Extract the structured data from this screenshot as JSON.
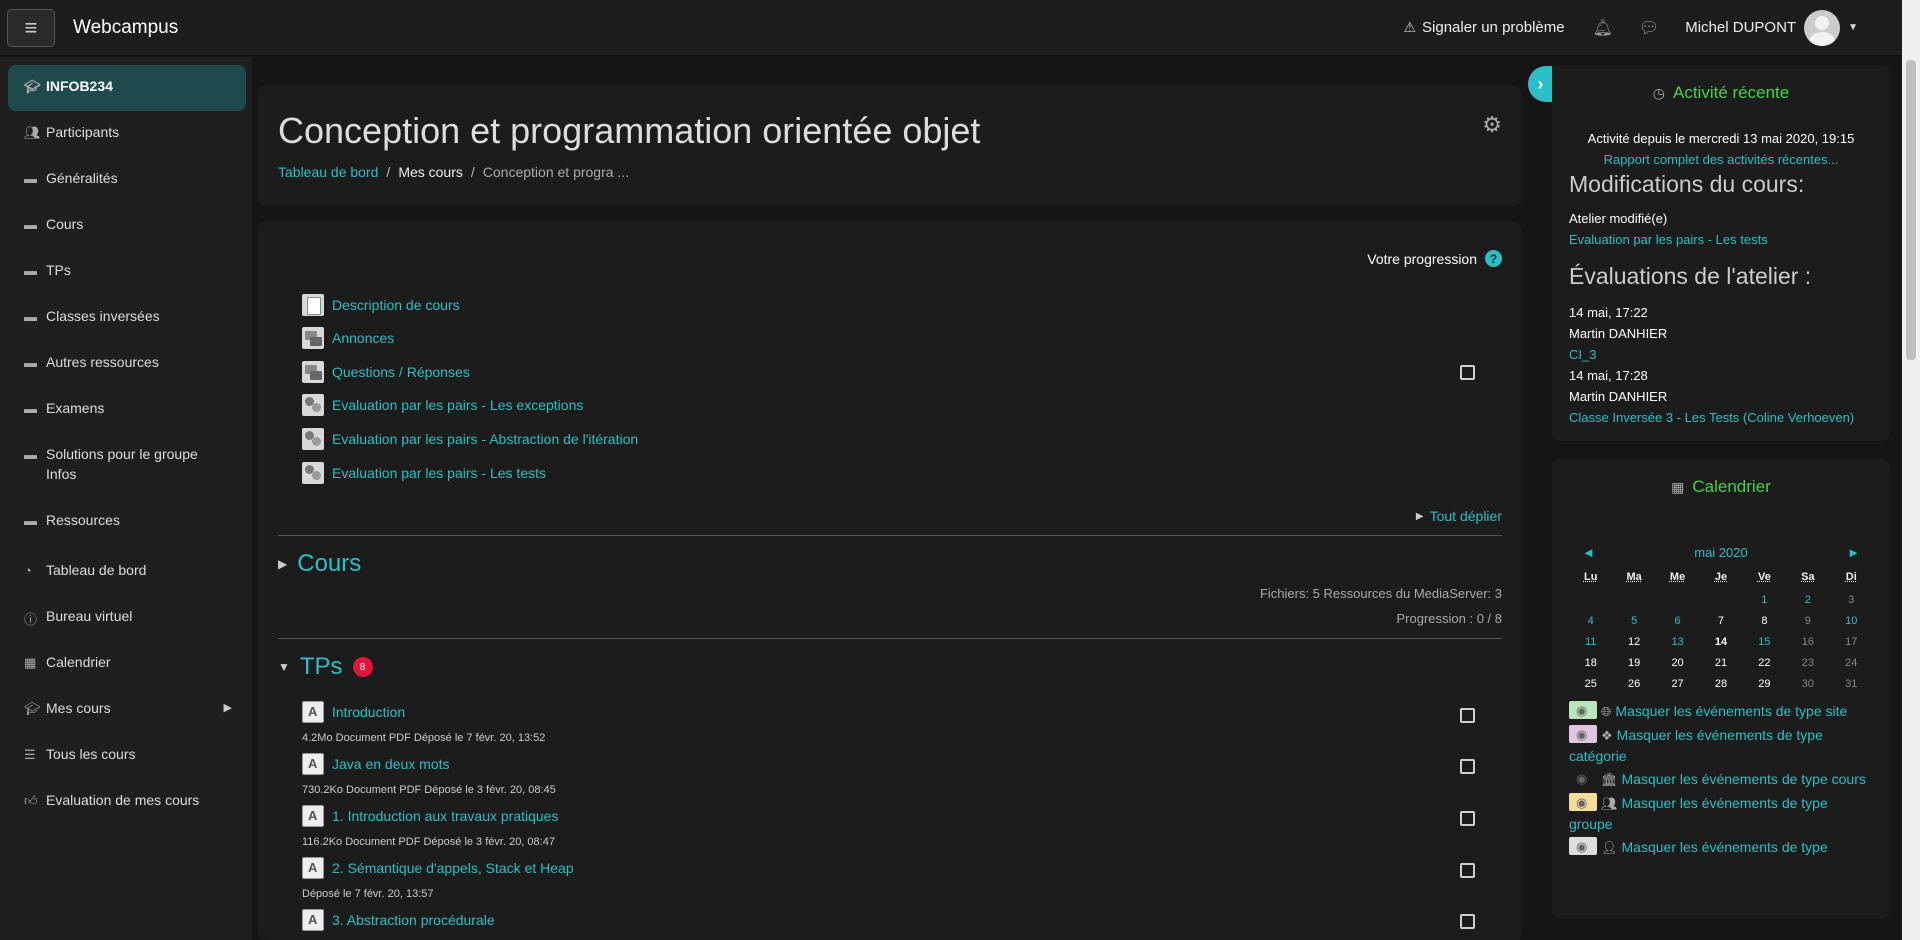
{
  "navbar": {
    "brand": "Webcampus",
    "report_label": "Signaler un problème",
    "user_name": "Michel DUPONT"
  },
  "sidebar": {
    "items": [
      {
        "label": "INFOB234",
        "icon": "graduation-cap-icon"
      },
      {
        "label": "Participants",
        "icon": "users-icon"
      },
      {
        "label": "Généralités",
        "icon": "folder-icon"
      },
      {
        "label": "Cours",
        "icon": "folder-icon"
      },
      {
        "label": "TPs",
        "icon": "folder-icon"
      },
      {
        "label": "Classes inversées",
        "icon": "folder-icon"
      },
      {
        "label": "Autres ressources",
        "icon": "folder-icon"
      },
      {
        "label": "Examens",
        "icon": "folder-icon"
      },
      {
        "label": "Solutions pour le groupe Infos",
        "icon": "folder-icon"
      },
      {
        "label": "Ressources",
        "icon": "folder-icon"
      },
      {
        "label": "Tableau de bord",
        "icon": "dashboard-icon"
      },
      {
        "label": "Bureau virtuel",
        "icon": "info-icon"
      },
      {
        "label": "Calendrier",
        "icon": "calendar-icon"
      },
      {
        "label": "Mes cours",
        "icon": "graduation-cap-icon"
      },
      {
        "label": "Tous les cours",
        "icon": "list-icon"
      },
      {
        "label": "Evaluation de mes cours",
        "icon": "thumbs-up-icon"
      }
    ]
  },
  "header": {
    "title": "Conception et programmation orientée objet",
    "breadcrumb": [
      "Tableau de bord",
      "Mes cours",
      "Conception et progra ..."
    ]
  },
  "main": {
    "progress_label": "Votre progression",
    "activities": [
      {
        "label": "Description de cours",
        "icon": "page-icon"
      },
      {
        "label": "Annonces",
        "icon": "forum-icon"
      },
      {
        "label": "Questions / Réponses",
        "icon": "forum-icon"
      },
      {
        "label": "Evaluation par les pairs - Les exceptions",
        "icon": "workshop-icon"
      },
      {
        "label": "Evaluation par les pairs - Abstraction de l'itération",
        "icon": "workshop-icon"
      },
      {
        "label": "Evaluation par les pairs - Les tests",
        "icon": "workshop-icon"
      }
    ],
    "expand_all": "Tout déplier",
    "sections": [
      {
        "title": "Cours",
        "meta1": "Fichiers: 5  Ressources du MediaServer: 3",
        "meta2": "Progression : 0 / 8"
      },
      {
        "title": "TPs",
        "badge": "8"
      }
    ],
    "tp_resources": [
      {
        "label": "Introduction",
        "meta": "4.2Mo Document PDF Déposé le 7 févr. 20, 13:52"
      },
      {
        "label": "Java en deux mots",
        "meta": "730.2Ko Document PDF Déposé le 3 févr. 20, 08:45"
      },
      {
        "label": "1. Introduction aux travaux pratiques",
        "meta": "116.2Ko Document PDF Déposé le 3 févr. 20, 08:47"
      },
      {
        "label": "2. Sémantique d'appels, Stack et Heap",
        "meta": "Déposé le 7 févr. 20, 13:57"
      },
      {
        "label": "3. Abstraction procédurale",
        "meta": ""
      }
    ]
  },
  "recent": {
    "title": "Activité récente",
    "since": "Activité depuis le mercredi 13 mai 2020, 19:15",
    "full_report": "Rapport complet des activités récentes...",
    "mods_heading": "Modifications du cours:",
    "mod_label": "Atelier modifié(e)",
    "mod_link": "Evaluation par les pairs - Les tests",
    "eval_heading": "Évaluations de l'atelier :",
    "evals": [
      {
        "time": "14 mai, 17:22",
        "name": "Martin DANHIER",
        "link": "CI_3"
      },
      {
        "time": "14 mai, 17:28",
        "name": "Martin DANHIER",
        "link": "Classe Inversée 3 - Les Tests (Coline Verhoeven)"
      }
    ]
  },
  "calendar": {
    "title": "Calendrier",
    "month": "mai 2020",
    "prev": "◄",
    "next": "►",
    "days": [
      "Lu",
      "Ma",
      "Me",
      "Je",
      "Ve",
      "Sa",
      "Di"
    ],
    "filters": [
      {
        "label": "Masquer les événements de type site",
        "icon": "globe-icon",
        "color": "#b8e6b8"
      },
      {
        "label": "Masquer les événements de type catégorie",
        "icon": "cubes-icon",
        "color": "#e0c4e0"
      },
      {
        "label": "Masquer les événements de type cours",
        "icon": "university-icon",
        "color": ""
      },
      {
        "label": "Masquer les événements de type groupe",
        "icon": "users-icon",
        "color": "#f6dc9a"
      },
      {
        "label": "Masquer les événements de type",
        "icon": "user-icon",
        "color": "#dddddd"
      }
    ]
  },
  "colors": {
    "accent": "#2bc0c6",
    "block_title": "#4cd04c",
    "badge": "#e0143c"
  }
}
